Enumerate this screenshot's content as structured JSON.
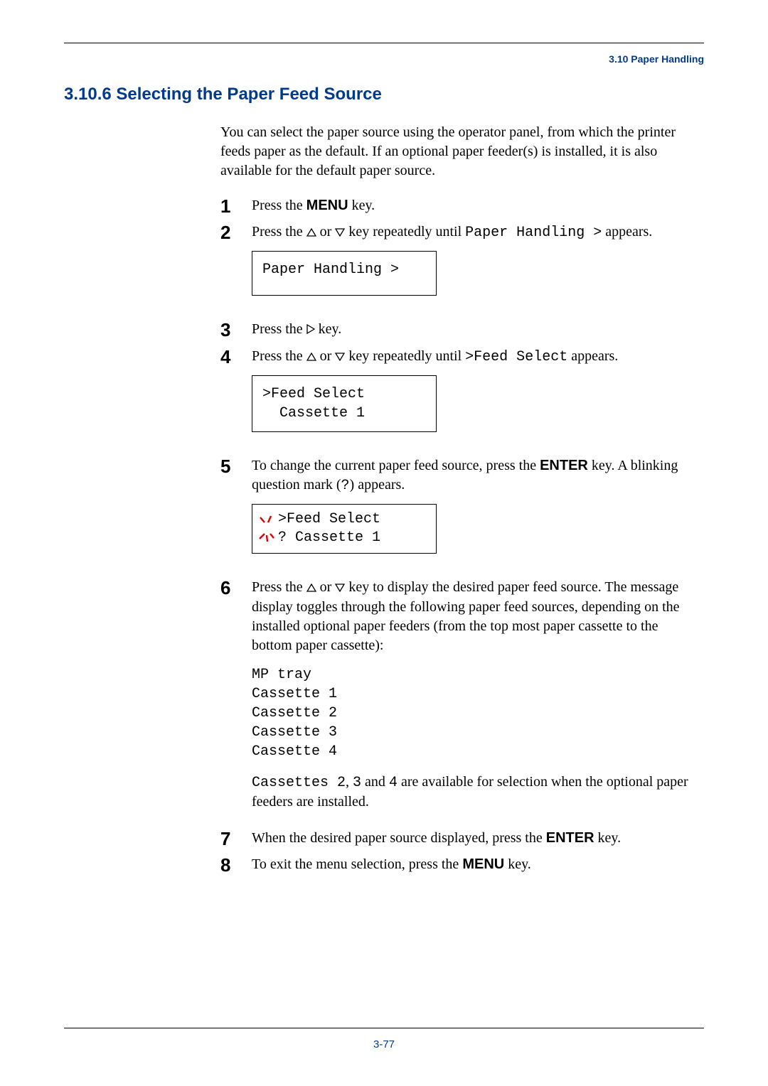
{
  "header": {
    "section_ref": "3.10 Paper Handling"
  },
  "title": "3.10.6   Selecting the Paper Feed Source",
  "intro": "You can select the paper source using the operator panel, from which the printer feeds paper as the default. If an optional paper feeder(s) is installed, it is also available for the default paper source.",
  "steps": {
    "s1": {
      "num": "1",
      "a": "Press the ",
      "key": "MENU",
      "b": " key."
    },
    "s2": {
      "num": "2",
      "a": "Press the ",
      "b": " or ",
      "c": " key repeatedly until ",
      "mono": "Paper Handling >",
      "d": " appears.",
      "lcd": "Paper Handling >"
    },
    "s3": {
      "num": "3",
      "a": "Press the ",
      "b": " key."
    },
    "s4": {
      "num": "4",
      "a": "Press the ",
      "b": " or ",
      "c": " key repeatedly until ",
      "mono": ">Feed Select",
      "d": " appears.",
      "lcd": ">Feed Select\n  Cassette 1"
    },
    "s5": {
      "num": "5",
      "a": "To change the current paper feed source, press the ",
      "key": "ENTER",
      "b": " key. A blinking question mark (",
      "mono": "?",
      "c": ") appears.",
      "lcd_l1": ">Feed Select",
      "lcd_l2": "? Cassette 1"
    },
    "s6": {
      "num": "6",
      "a": "Press the ",
      "b": " or ",
      "c": " key to display the desired paper feed source. The message display toggles through the following paper feed sources, depending on the installed optional paper feeders (from the top most paper cassette to the bottom paper cassette):",
      "list": "MP tray\nCassette 1\nCassette 2\nCassette 3\nCassette 4",
      "note_a": "Cassettes 2",
      "note_b": ", ",
      "note_c": "3",
      "note_d": " and ",
      "note_e": "4",
      "note_f": " are available for selection when the optional paper feeders are installed."
    },
    "s7": {
      "num": "7",
      "a": "When the desired paper source displayed, press the ",
      "key": "ENTER",
      "b": " key."
    },
    "s8": {
      "num": "8",
      "a": "To exit the menu selection, press the ",
      "key": "MENU",
      "b": " key."
    }
  },
  "page_number": "3-77"
}
